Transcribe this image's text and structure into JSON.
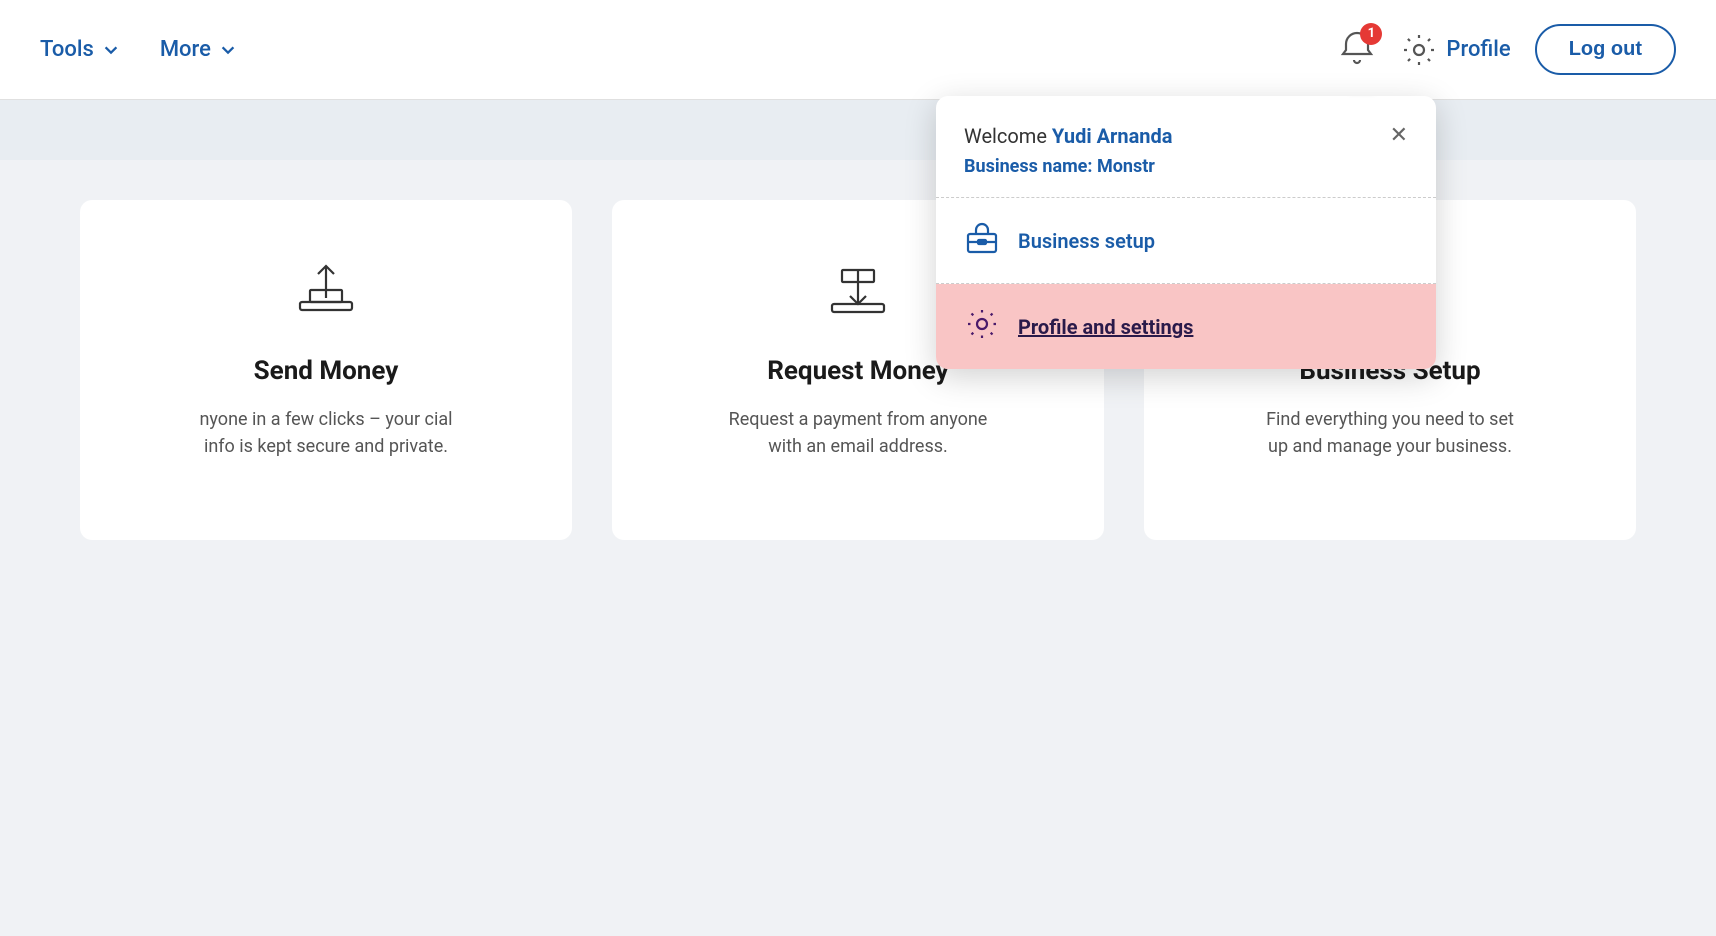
{
  "header": {
    "tools_label": "Tools",
    "more_label": "More",
    "bell_badge": "1",
    "profile_label": "Profile",
    "logout_label": "Log out"
  },
  "popup": {
    "welcome_prefix": "Welcome ",
    "user_name": "Yudi Arnanda",
    "business_label": "Business name:",
    "business_name": "Monstr",
    "menu_items": [
      {
        "id": "business-setup",
        "label": "Business setup",
        "icon": "briefcase",
        "active": false
      },
      {
        "id": "profile-settings",
        "label": "Profile and settings",
        "icon": "gear",
        "active": true
      }
    ]
  },
  "cards": [
    {
      "id": "send-money",
      "title": "Send Money",
      "description": "nyone in a few clicks – your cial info is kept secure and private.",
      "icon": "upload"
    },
    {
      "id": "request-money",
      "title": "Request Money",
      "description": "Request a payment from anyone with an email address.",
      "icon": "download"
    },
    {
      "id": "business-setup",
      "title": "Business Setup",
      "description": "Find everything you need to set up and manage your business.",
      "icon": "briefcase"
    }
  ]
}
